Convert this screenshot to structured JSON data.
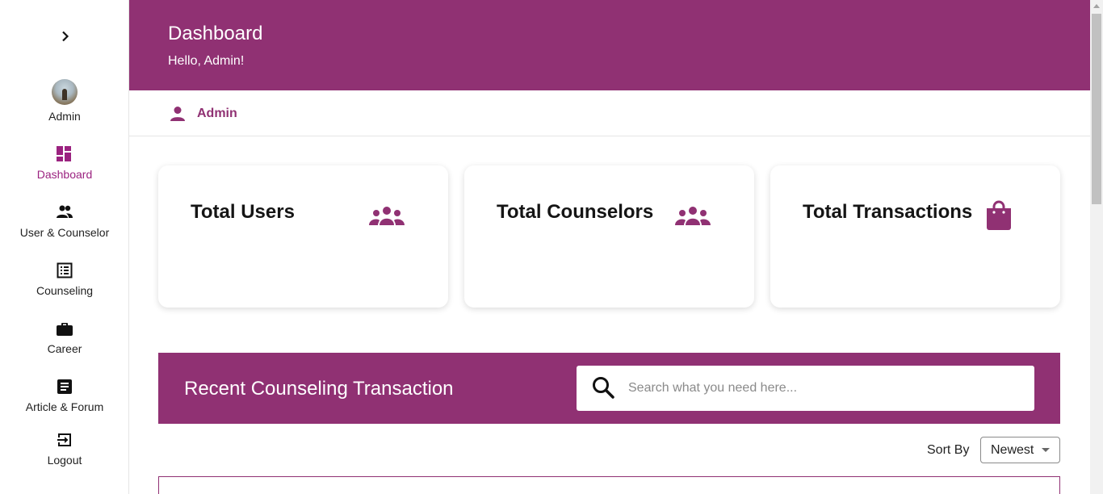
{
  "sidebar": {
    "items": [
      {
        "label": "Admin"
      },
      {
        "label": "Dashboard"
      },
      {
        "label": "User & Counselor"
      },
      {
        "label": "Counseling"
      },
      {
        "label": "Career"
      },
      {
        "label": "Article & Forum"
      },
      {
        "label": "Logout"
      }
    ],
    "active_color": "#9b2380"
  },
  "header": {
    "title": "Dashboard",
    "subtitle": "Hello, Admin!",
    "background": "#903173"
  },
  "userbar": {
    "name": "Admin"
  },
  "cards": [
    {
      "title": "Total Users",
      "icon": "users-group-icon"
    },
    {
      "title": "Total Counselors",
      "icon": "users-group-icon"
    },
    {
      "title": "Total Transactions",
      "icon": "shopping-bag-icon"
    }
  ],
  "transactions": {
    "title": "Recent Counseling Transaction",
    "search_placeholder": "Search what you need here...",
    "sort_label": "Sort By",
    "sort_value": "Newest"
  }
}
